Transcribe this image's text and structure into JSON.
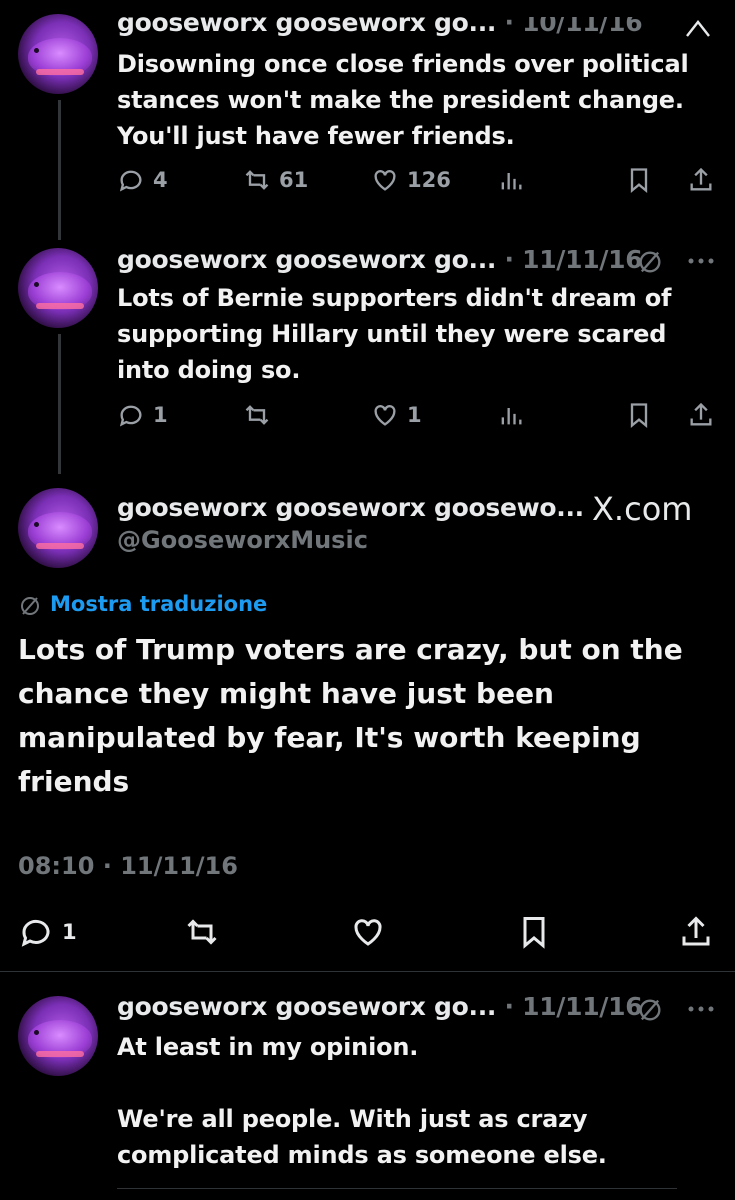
{
  "tweets": [
    {
      "author": "gooseworx gooseworx go...",
      "date": "· 10/11/16",
      "text": "Disowning once close friends over political stances won't make the president change. You'll just have fewer friends.",
      "replies": "4",
      "reposts": "61",
      "likes": "126"
    },
    {
      "author": "gooseworx gooseworx go...",
      "date": "· 11/11/16",
      "text": "Lots of Bernie supporters didn't dream of supporting Hillary until they were scared into doing so.",
      "replies": "1",
      "reposts": "",
      "likes": "1"
    }
  ],
  "main_tweet": {
    "author": "gooseworx gooseworx goosewo...",
    "handle": "@GooseworxMusic",
    "watermark": "X.com",
    "translate_label": "Mostra traduzione",
    "text_line1": "Lots of Trump voters are crazy, but on the",
    "text_line2": "chance they might have just been",
    "text_line3": "manipulated by fear, It's worth keeping",
    "text_line4": "friends",
    "timestamp": "08:10 · 11/11/16",
    "replies": "1"
  },
  "reply_tweet": {
    "author": "gooseworx gooseworx go...",
    "date": "· 11/11/16",
    "text_line1": "At least in my opinion.",
    "text_line2": "We're all people. With just as crazy",
    "text_line3": "complicated minds as someone else."
  },
  "colors": {
    "background": "#000000",
    "text": "#e7e9ea",
    "muted": "#71767b",
    "link": "#1d9bf0"
  }
}
